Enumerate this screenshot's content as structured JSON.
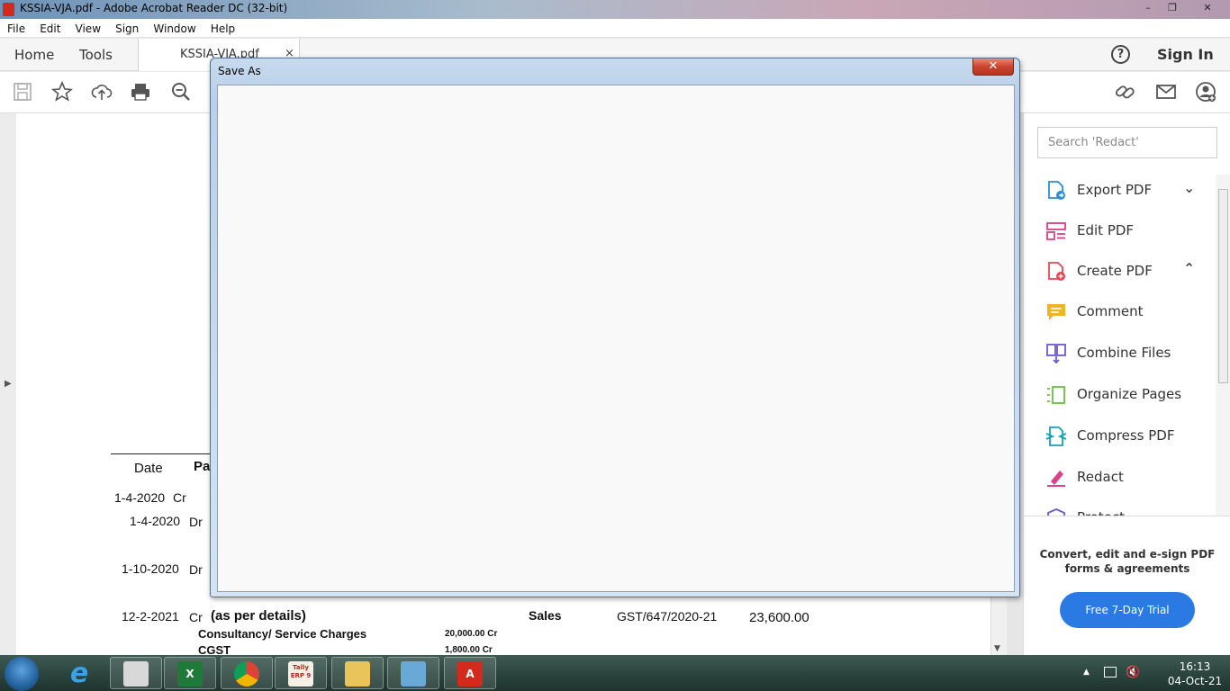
{
  "window": {
    "title": "KSSIA-VJA.pdf - Adobe Acrobat Reader DC (32-bit)",
    "minimize": "–",
    "maximize": "❐",
    "close": "✕"
  },
  "menu": [
    "File",
    "Edit",
    "View",
    "Sign",
    "Window",
    "Help"
  ],
  "tabs": {
    "home": "Home",
    "tools": "Tools",
    "document": "KSSIA-VJA.pdf",
    "document_close": "×",
    "help": "?",
    "sign_in": "Sign In"
  },
  "toolbar_icons": [
    "save-icon",
    "bookmark-star-icon",
    "upload-cloud-icon",
    "print-icon",
    "zoom-icon",
    "share-link-icon",
    "email-icon",
    "add-user-icon"
  ],
  "document": {
    "headers": {
      "date": "Date",
      "particulars": "Pa"
    },
    "rows": [
      {
        "date": "1-4-2020",
        "type": "Cr"
      },
      {
        "date": "1-4-2020",
        "type": "Dr"
      },
      {
        "date": "1-10-2020",
        "type": "Dr"
      },
      {
        "date": "12-2-2021",
        "type": "Cr",
        "particulars": "(as per details)",
        "account": "Sales",
        "voucher": "GST/647/2020-21",
        "amount": "23,600.00"
      }
    ],
    "details": [
      {
        "label": "Consultancy/ Service Charges",
        "amount": "20,000.00 Cr"
      },
      {
        "label": "CGST",
        "amount": "1,800.00 Cr"
      }
    ]
  },
  "right_panel": {
    "search_placeholder": "Search 'Redact'",
    "tools": [
      {
        "label": "Export PDF",
        "icon": "export-pdf-icon",
        "color": "#2a8fd6",
        "chevron": "⌄"
      },
      {
        "label": "Edit PDF",
        "icon": "edit-pdf-icon",
        "color": "#d9418a"
      },
      {
        "label": "Create PDF",
        "icon": "create-pdf-icon",
        "color": "#e34850",
        "chevron": "⌃"
      },
      {
        "label": "Comment",
        "icon": "comment-icon",
        "color": "#f0b429"
      },
      {
        "label": "Combine Files",
        "icon": "combine-files-icon",
        "color": "#6a5acd"
      },
      {
        "label": "Organize Pages",
        "icon": "organize-pages-icon",
        "color": "#6cbf3c"
      },
      {
        "label": "Compress PDF",
        "icon": "compress-pdf-icon",
        "color": "#14a3b8"
      },
      {
        "label": "Redact",
        "icon": "redact-icon",
        "color": "#d9418a"
      },
      {
        "label": "Protect",
        "icon": "protect-icon",
        "color": "#6a5acd"
      }
    ],
    "promo": "Convert, edit and e-sign PDF forms & agreements",
    "trial_button": "Free 7-Day Trial"
  },
  "dialog": {
    "title": "Save As",
    "close": "✕"
  },
  "taskbar": {
    "apps": [
      "internet-explorer",
      "excel-like-app",
      "excel",
      "chrome",
      "tally-erp9",
      "file-explorer",
      "control-panel",
      "acrobat-reader"
    ],
    "tally_label": "Tally ERP 9",
    "time": "16:13",
    "date": "04-Oct-21"
  }
}
